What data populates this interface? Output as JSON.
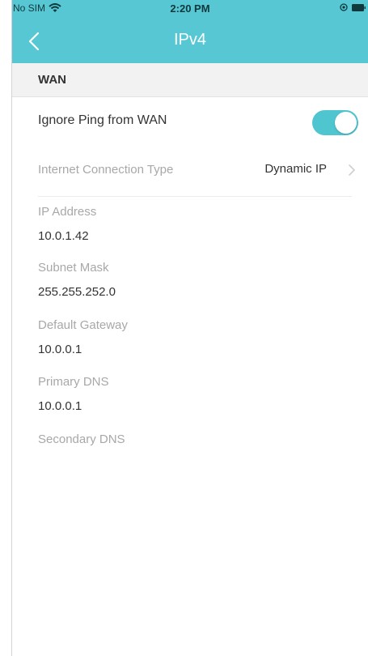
{
  "status_bar": {
    "carrier": "No SIM",
    "time": "2:20 PM"
  },
  "nav": {
    "title": "IPv4"
  },
  "section": {
    "title": "WAN"
  },
  "ping": {
    "label": "Ignore Ping from WAN",
    "enabled": true
  },
  "connection": {
    "label": "Internet Connection Type",
    "value": "Dynamic IP"
  },
  "fields": [
    {
      "label": "IP Address",
      "value": "10.0.1.42"
    },
    {
      "label": "Subnet Mask",
      "value": "255.255.252.0"
    },
    {
      "label": "Default Gateway",
      "value": "10.0.0.1"
    },
    {
      "label": "Primary DNS",
      "value": "10.0.0.1"
    },
    {
      "label": "Secondary DNS",
      "value": ""
    }
  ],
  "colors": {
    "header": "#57c8d3",
    "toggle_on": "#4fc5d0",
    "label_gray": "#a8a8a8",
    "text_dark": "#333333"
  },
  "icons": [
    "wifi-icon",
    "location-icon",
    "battery-icon",
    "chevron-left-icon",
    "chevron-right-icon"
  ]
}
